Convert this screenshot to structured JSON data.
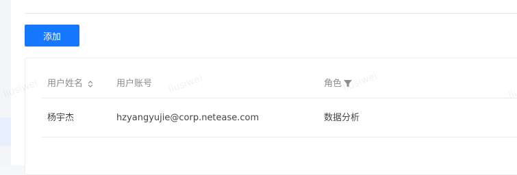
{
  "toolbar": {
    "add_label": "添加"
  },
  "table": {
    "columns": [
      {
        "label": "用户姓名",
        "sortable": true,
        "icon": "sort-icon"
      },
      {
        "label": "用户账号"
      },
      {
        "label": "角色",
        "filterable": true,
        "icon": "filter-icon"
      }
    ],
    "rows": [
      {
        "name": "杨宇杰",
        "account": "hzyangyujie@corp.netease.com",
        "role": "数据分析"
      }
    ]
  },
  "watermark": {
    "text": "liusiwei"
  },
  "colors": {
    "primary": "#1677ff",
    "header_text": "#8c8c8c",
    "body_text": "#444444",
    "divider": "#ebebeb"
  }
}
